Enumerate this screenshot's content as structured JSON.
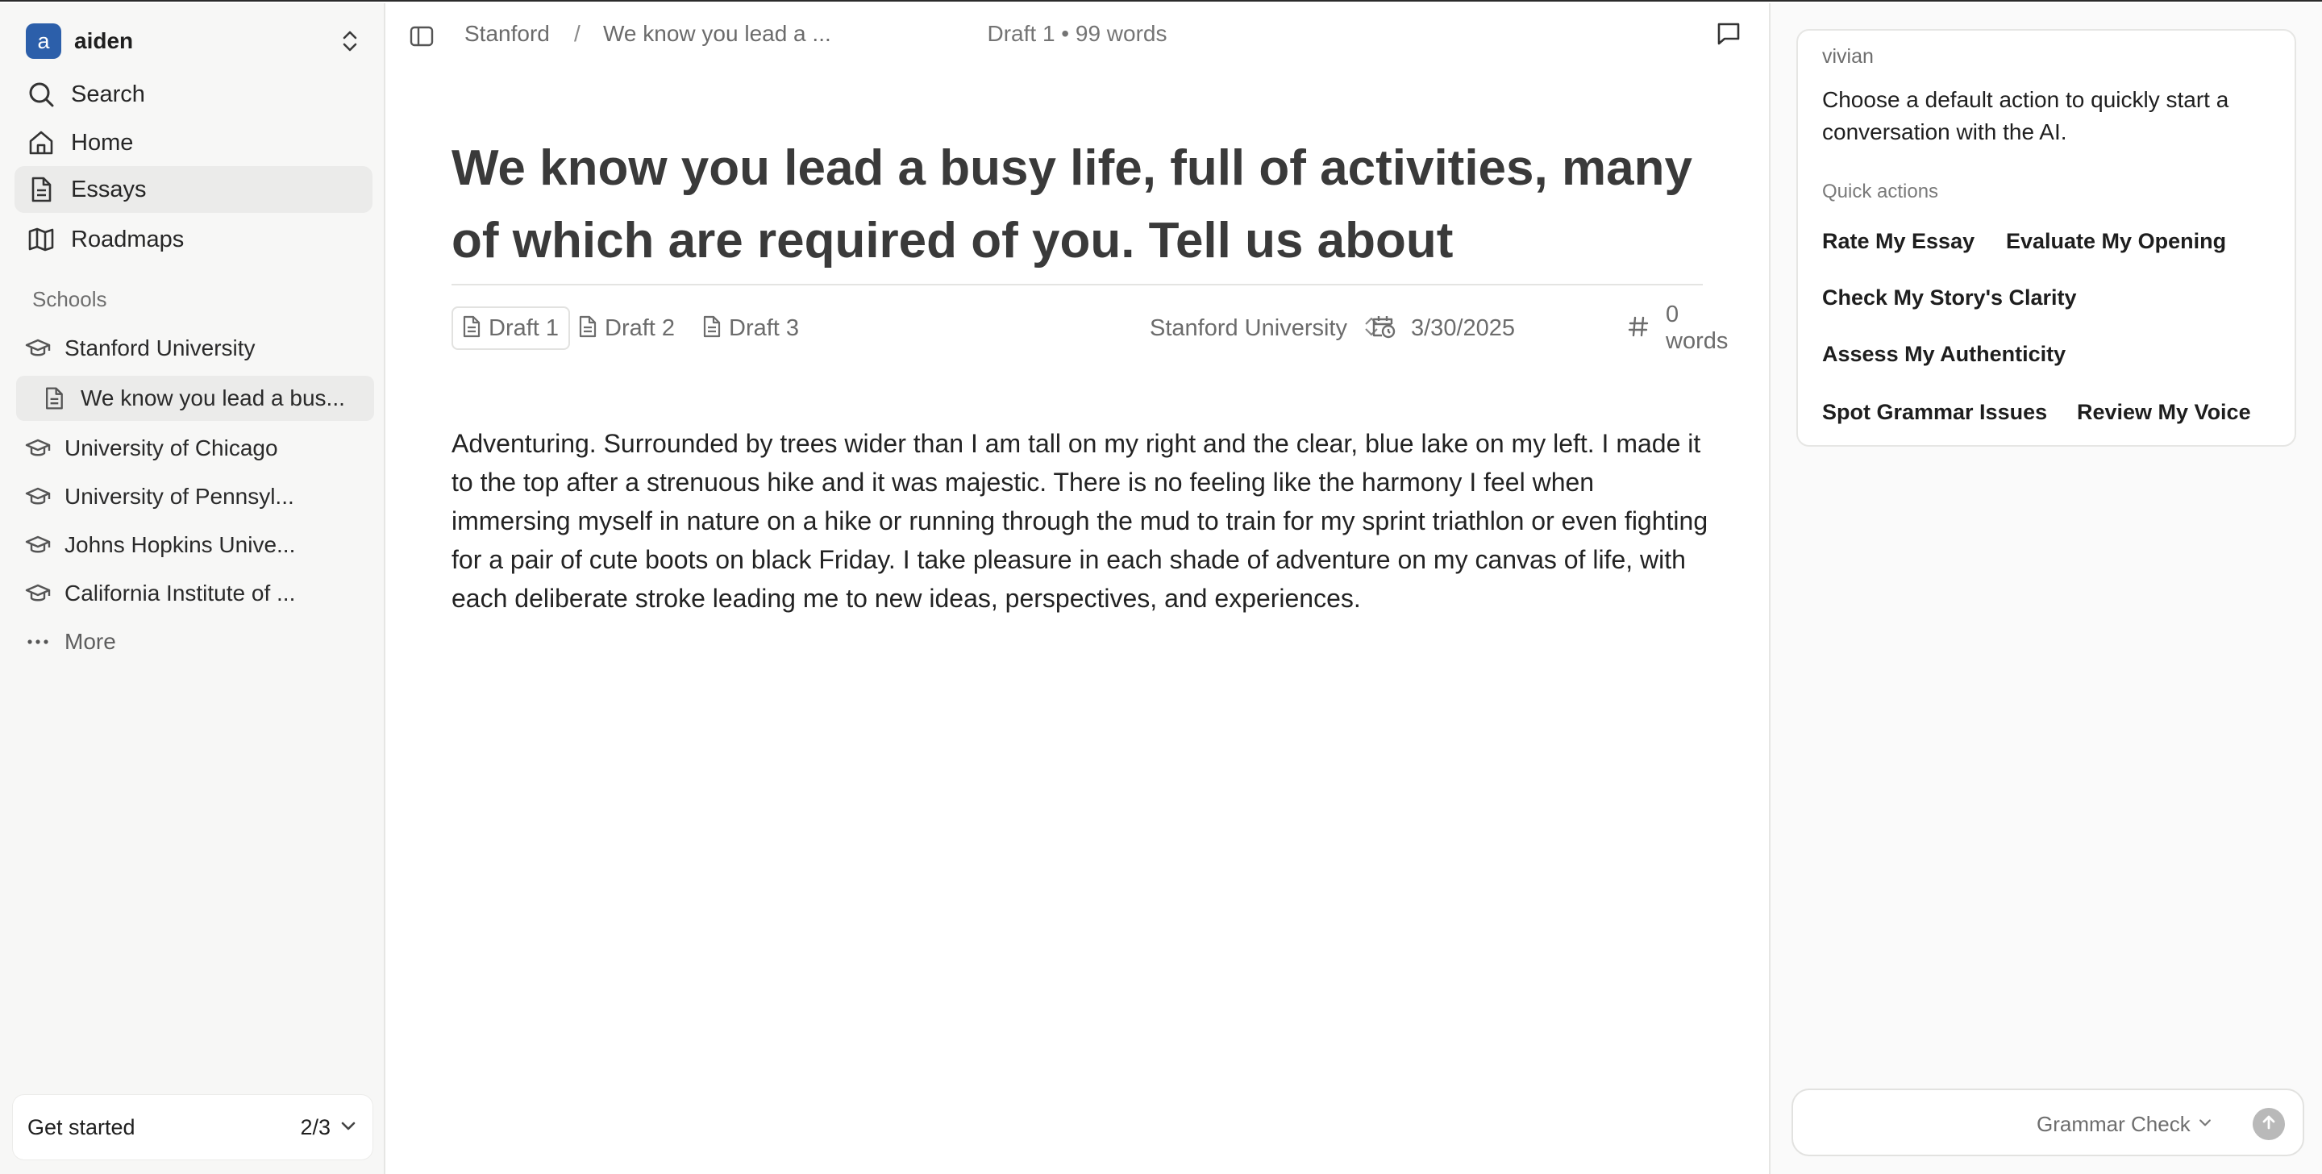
{
  "workspace": {
    "avatar_letter": "a",
    "name": "aiden"
  },
  "nav": {
    "search": "Search",
    "home": "Home",
    "essays": "Essays",
    "roadmaps": "Roadmaps"
  },
  "schools": {
    "section_label": "Schools",
    "items": [
      {
        "label": "Stanford University"
      },
      {
        "label": "We know you lead a bus..."
      },
      {
        "label": "University of Chicago"
      },
      {
        "label": "University of Pennsyl..."
      },
      {
        "label": "Johns Hopkins Unive..."
      },
      {
        "label": "California Institute of ..."
      }
    ],
    "more": "More"
  },
  "get_started": {
    "label": "Get started",
    "progress": "2/3"
  },
  "topbar": {
    "crumbs": [
      "Stanford",
      "We know you lead a ..."
    ],
    "separator": "/",
    "draft_status": "Draft 1 • 99 words"
  },
  "essay": {
    "title": "We know you lead a busy life, full of activities, many of which are required of you. Tell us about something you do simply for the pleasure of it and why you love it.",
    "drafts": [
      "Draft 1",
      "Draft 2",
      "Draft 3"
    ],
    "active_draft": 0,
    "school": "Stanford University",
    "date": "3/30/2025",
    "word_count": "0 words",
    "body": "Adventuring. Surrounded by trees wider than I am tall on my right and the clear, blue lake on my left. I made it to the top after a strenuous hike and it was majestic. There is no feeling like the harmony I feel when immersing myself in nature on a hike or running through the mud to train for my sprint triathlon or even fighting for a pair of cute boots on black Friday. I take pleasure in each shade of adventure on my canvas of life, with each deliberate stroke leading me to new ideas, perspectives, and experiences."
  },
  "assistant": {
    "name": "vivian",
    "prompt": "Choose a default action to quickly start a conversation with the AI.",
    "quick_actions_label": "Quick actions",
    "quick_actions": [
      "Rate My Essay",
      "Evaluate My Opening",
      "Check My Story's Clarity",
      "Assess My Authenticity",
      "Spot Grammar Issues",
      "Review My Voice"
    ],
    "input_value": "",
    "input_placeholder": "",
    "mode": "Grammar Check"
  },
  "colors": {
    "accent": "#2c5faa",
    "sidebar_bg": "#f7f7f6",
    "active_item_bg": "#ebebea",
    "send_button": "#b9b9b9"
  }
}
